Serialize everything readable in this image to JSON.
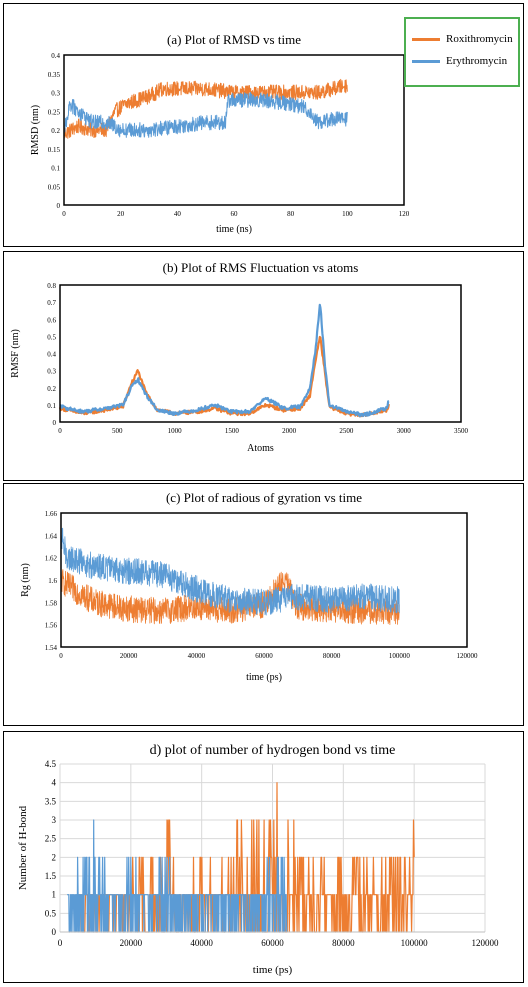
{
  "colors": {
    "roxithromycin": "#ED7D31",
    "erythromycin": "#5B9BD5",
    "legend_border": "#4CAF50"
  },
  "legend": {
    "items": [
      {
        "label": "Roxithromycin",
        "color": "#ED7D31"
      },
      {
        "label": "Erythromycin",
        "color": "#5B9BD5"
      }
    ]
  },
  "chart_data": [
    {
      "id": "a",
      "type": "line",
      "title": "(a) Plot of RMSD vs time",
      "xlabel": "time (ns)",
      "ylabel": "RMSD (nm)",
      "xlim": [
        0,
        120
      ],
      "ylim": [
        0,
        0.4
      ],
      "xticks": [
        0,
        20,
        40,
        60,
        80,
        100,
        120
      ],
      "xtick_labels": [
        "0",
        "20",
        "40",
        "60",
        "80",
        "100",
        "120"
      ],
      "yticks": [
        0,
        0.05,
        0.1,
        0.15,
        0.2,
        0.25,
        0.3,
        0.35,
        0.4
      ],
      "ytick_labels": [
        "0",
        "0.05",
        "0.1",
        "0.15",
        "0.2",
        "0.25",
        "0.3",
        "0.35",
        "0.4"
      ],
      "grid": false,
      "series": [
        {
          "name": "Erythromycin",
          "color": "#5B9BD5",
          "x": [
            0,
            2,
            5,
            10,
            15,
            18,
            20,
            30,
            40,
            50,
            57,
            58,
            70,
            80,
            85,
            90,
            95,
            100
          ],
          "y": [
            0.19,
            0.27,
            0.25,
            0.22,
            0.22,
            0.21,
            0.2,
            0.2,
            0.21,
            0.22,
            0.22,
            0.28,
            0.28,
            0.27,
            0.26,
            0.22,
            0.23,
            0.23
          ]
        },
        {
          "name": "Roxithromycin",
          "color": "#ED7D31",
          "x": [
            0,
            5,
            10,
            15,
            18,
            22,
            30,
            35,
            40,
            50,
            60,
            70,
            80,
            90,
            100
          ],
          "y": [
            0.19,
            0.21,
            0.2,
            0.2,
            0.25,
            0.27,
            0.29,
            0.31,
            0.31,
            0.31,
            0.3,
            0.3,
            0.3,
            0.3,
            0.32
          ]
        }
      ]
    },
    {
      "id": "b",
      "type": "line",
      "title": "(b) Plot of RMS Fluctuation vs atoms",
      "xlabel": "Atoms",
      "ylabel": "RMSF (nm)",
      "xlim": [
        0,
        3500
      ],
      "ylim": [
        0,
        0.8
      ],
      "xticks": [
        0,
        500,
        1000,
        1500,
        2000,
        2500,
        3000,
        3500
      ],
      "xtick_labels": [
        "0",
        "500",
        "1000",
        "1500",
        "2000",
        "2500",
        "3000",
        "3500"
      ],
      "yticks": [
        0,
        0.1,
        0.2,
        0.3,
        0.4,
        0.5,
        0.6,
        0.7,
        0.8
      ],
      "ytick_labels": [
        "0",
        "0.1",
        "0.2",
        "0.3",
        "0.4",
        "0.5",
        "0.6",
        "0.7",
        "0.8"
      ],
      "grid": false,
      "series": [
        {
          "name": "Erythromycin",
          "color": "#5B9BD5",
          "x": [
            0,
            200,
            400,
            550,
            620,
            680,
            750,
            850,
            1000,
            1200,
            1350,
            1500,
            1650,
            1800,
            1950,
            2100,
            2180,
            2230,
            2270,
            2310,
            2350,
            2500,
            2650,
            2850,
            2870
          ],
          "y": [
            0.09,
            0.06,
            0.08,
            0.1,
            0.2,
            0.25,
            0.16,
            0.07,
            0.05,
            0.07,
            0.1,
            0.06,
            0.06,
            0.14,
            0.08,
            0.09,
            0.2,
            0.42,
            0.7,
            0.35,
            0.1,
            0.06,
            0.04,
            0.08,
            0.13
          ]
        },
        {
          "name": "Roxithromycin",
          "color": "#ED7D31",
          "x": [
            0,
            200,
            400,
            550,
            620,
            680,
            750,
            850,
            1000,
            1200,
            1350,
            1500,
            1650,
            1800,
            1950,
            2100,
            2180,
            2230,
            2270,
            2310,
            2350,
            2500,
            2650,
            2850,
            2870
          ],
          "y": [
            0.08,
            0.05,
            0.07,
            0.09,
            0.22,
            0.3,
            0.17,
            0.07,
            0.05,
            0.06,
            0.08,
            0.05,
            0.05,
            0.1,
            0.07,
            0.08,
            0.15,
            0.36,
            0.5,
            0.3,
            0.09,
            0.05,
            0.04,
            0.07,
            0.1
          ]
        }
      ]
    },
    {
      "id": "c",
      "type": "line",
      "title": "(c) Plot of radious of gyration vs time",
      "xlabel": "time (ps)",
      "ylabel": "Rg (nm)",
      "xlim": [
        0,
        120000
      ],
      "ylim": [
        1.54,
        1.66
      ],
      "xticks": [
        0,
        20000,
        40000,
        60000,
        80000,
        100000,
        120000
      ],
      "xtick_labels": [
        "0",
        "20000",
        "40000",
        "60000",
        "80000",
        "100000",
        "120000"
      ],
      "yticks": [
        1.54,
        1.56,
        1.58,
        1.6,
        1.62,
        1.64,
        1.66
      ],
      "ytick_labels": [
        "1.54",
        "1.56",
        "1.58",
        "1.6",
        "1.62",
        "1.64",
        "1.66"
      ],
      "grid": false,
      "series": [
        {
          "name": "Erythromycin",
          "color": "#5B9BD5",
          "x": [
            0,
            2000,
            10000,
            20000,
            30000,
            40000,
            50000,
            60000,
            70000,
            80000,
            90000,
            100000
          ],
          "y": [
            1.64,
            1.62,
            1.612,
            1.608,
            1.605,
            1.592,
            1.582,
            1.58,
            1.585,
            1.582,
            1.585,
            1.582
          ]
        },
        {
          "name": "Roxithromycin",
          "color": "#ED7D31",
          "x": [
            0,
            2000,
            10000,
            20000,
            30000,
            40000,
            50000,
            60000,
            66000,
            70000,
            80000,
            90000,
            100000
          ],
          "y": [
            1.6,
            1.595,
            1.58,
            1.574,
            1.572,
            1.576,
            1.572,
            1.578,
            1.6,
            1.576,
            1.574,
            1.572,
            1.572
          ]
        }
      ]
    },
    {
      "id": "d",
      "type": "line",
      "title": "d) plot of number of hydrogen bond vs time",
      "xlabel": "time (ps)",
      "ylabel": "Number of H-bond",
      "xlim": [
        0,
        120000
      ],
      "ylim": [
        0,
        4.5
      ],
      "xticks": [
        0,
        20000,
        40000,
        60000,
        80000,
        100000,
        120000
      ],
      "xtick_labels": [
        "0",
        "20000",
        "40000",
        "60000",
        "80000",
        "100000",
        "120000"
      ],
      "yticks": [
        0,
        0.5,
        1,
        1.5,
        2,
        2.5,
        3,
        3.5,
        4,
        4.5
      ],
      "ytick_labels": [
        "0",
        "0.5",
        "1",
        "1.5",
        "2",
        "2.5",
        "3",
        "3.5",
        "4",
        "4.5"
      ],
      "grid": true,
      "series": [
        {
          "name": "Erythromycin",
          "color": "#5B9BD5",
          "x": [
            2000,
            6000,
            9000,
            12000,
            16000,
            20000,
            25000,
            30000,
            33000,
            36000,
            64000
          ],
          "y": [
            1,
            2,
            3,
            2,
            1,
            2,
            1,
            2,
            1,
            1,
            2
          ]
        },
        {
          "name": "Roxithromycin",
          "color": "#ED7D31",
          "x": [
            5000,
            28000,
            31000,
            34000,
            45000,
            50000,
            55000,
            60000,
            65000,
            75000,
            80000,
            85000,
            95000,
            100000
          ],
          "y": [
            1,
            2,
            3,
            2,
            2,
            4,
            3,
            4,
            3,
            2,
            4,
            2,
            2,
            3
          ]
        }
      ]
    }
  ]
}
